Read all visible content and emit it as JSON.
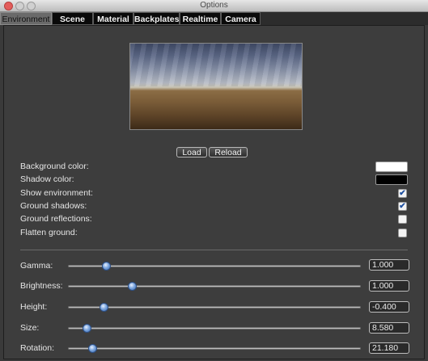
{
  "window": {
    "title": "Options"
  },
  "tabs": [
    "Environment",
    "Scene",
    "Material",
    "Backplates",
    "Realtime",
    "Camera"
  ],
  "active_tab": "Environment",
  "buttons": {
    "load": "Load",
    "reload": "Reload"
  },
  "settings": {
    "background_color": {
      "label": "Background color:",
      "color": "#ffffff"
    },
    "shadow_color": {
      "label": "Shadow color:",
      "color": "#000000"
    },
    "show_environment": {
      "label": "Show environment:",
      "checked": true
    },
    "ground_shadows": {
      "label": "Ground shadows:",
      "checked": true
    },
    "ground_reflections": {
      "label": "Ground reflections:",
      "checked": false
    },
    "flatten_ground": {
      "label": "Flatten ground:",
      "checked": false
    }
  },
  "sliders": [
    {
      "label": "Gamma:",
      "value": "1.000",
      "position": 0.12
    },
    {
      "label": "Brightness:",
      "value": "1.000",
      "position": 0.21
    },
    {
      "label": "Height:",
      "value": "-0.400",
      "position": 0.11
    },
    {
      "label": "Size:",
      "value": "8.580",
      "position": 0.05
    },
    {
      "label": "Rotation:",
      "value": "21.180",
      "position": 0.07
    }
  ],
  "icons": {
    "checkmark": "✔"
  }
}
